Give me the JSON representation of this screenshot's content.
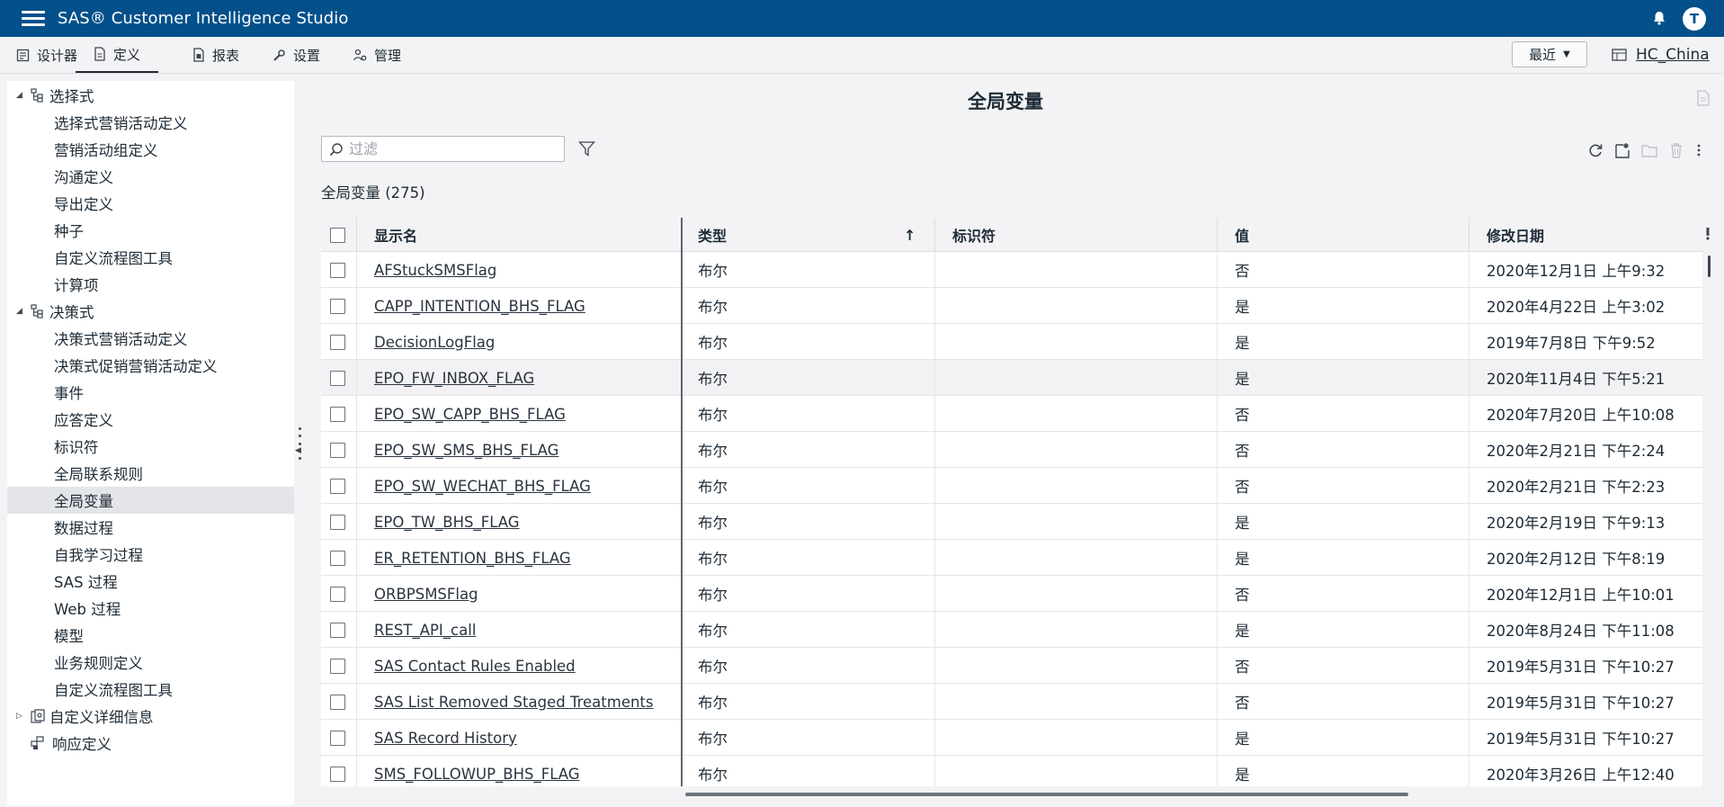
{
  "app": {
    "title": "SAS® Customer Intelligence Studio",
    "user_initial": "T"
  },
  "menubar": {
    "items": [
      {
        "label": "设计器",
        "icon": "designer-icon"
      },
      {
        "label": "定义",
        "icon": "document-icon"
      },
      {
        "label": "报表",
        "icon": "report-icon"
      },
      {
        "label": "设置",
        "icon": "wrench-icon"
      },
      {
        "label": "管理",
        "icon": "admin-icon"
      }
    ],
    "recent_label": "最近",
    "workspace_label": "HC_China"
  },
  "sidebar": {
    "groups": [
      {
        "label": "选择式",
        "expanded": true,
        "children": [
          "选择式营销活动定义",
          "营销活动组定义",
          "沟通定义",
          "导出定义",
          "种子",
          "自定义流程图工具",
          "计算项"
        ]
      },
      {
        "label": "决策式",
        "expanded": true,
        "children": [
          "决策式营销活动定义",
          "决策式促销营销活动定义",
          "事件",
          "应答定义",
          "标识符",
          "全局联系规则",
          "全局变量",
          "数据过程",
          "自我学习过程",
          "SAS 过程",
          "Web 过程",
          "模型",
          "业务规则定义",
          "自定义流程图工具"
        ]
      },
      {
        "label": "自定义详细信息",
        "expanded": false,
        "children": []
      },
      {
        "label": "响应定义",
        "expanded": null,
        "children": []
      }
    ],
    "selected": "全局变量"
  },
  "main": {
    "title": "全局变量",
    "filter_placeholder": "过滤",
    "count_label": "全局变量 (275)",
    "columns": [
      "显示名",
      "类型",
      "标识符",
      "值",
      "修改日期"
    ],
    "sort_column": "类型",
    "sort_direction": "ascending",
    "rows": [
      {
        "name": "AFStuckSMSFlag",
        "type": "布尔",
        "identifier": "",
        "value": "否",
        "modified": "2020年12月1日 上午9:32"
      },
      {
        "name": "CAPP_INTENTION_BHS_FLAG",
        "type": "布尔",
        "identifier": "",
        "value": "是",
        "modified": "2020年4月22日 上午3:02"
      },
      {
        "name": "DecisionLogFlag",
        "type": "布尔",
        "identifier": "",
        "value": "是",
        "modified": "2019年7月8日 下午9:52"
      },
      {
        "name": "EPO_FW_INBOX_FLAG",
        "type": "布尔",
        "identifier": "",
        "value": "是",
        "modified": "2020年11月4日 下午5:21"
      },
      {
        "name": "EPO_SW_CAPP_BHS_FLAG",
        "type": "布尔",
        "identifier": "",
        "value": "否",
        "modified": "2020年7月20日 上午10:08"
      },
      {
        "name": "EPO_SW_SMS_BHS_FLAG",
        "type": "布尔",
        "identifier": "",
        "value": "否",
        "modified": "2020年2月21日 下午2:24"
      },
      {
        "name": "EPO_SW_WECHAT_BHS_FLAG",
        "type": "布尔",
        "identifier": "",
        "value": "否",
        "modified": "2020年2月21日 下午2:23"
      },
      {
        "name": "EPO_TW_BHS_FLAG",
        "type": "布尔",
        "identifier": "",
        "value": "是",
        "modified": "2020年2月19日 下午9:13"
      },
      {
        "name": "ER_RETENTION_BHS_FLAG",
        "type": "布尔",
        "identifier": "",
        "value": "是",
        "modified": "2020年2月12日 下午8:19"
      },
      {
        "name": "ORBPSMSFlag",
        "type": "布尔",
        "identifier": "",
        "value": "否",
        "modified": "2020年12月1日 上午10:01"
      },
      {
        "name": "REST_API_call",
        "type": "布尔",
        "identifier": "",
        "value": "是",
        "modified": "2020年8月24日 下午11:08"
      },
      {
        "name": "SAS Contact Rules Enabled",
        "type": "布尔",
        "identifier": "",
        "value": "否",
        "modified": "2019年5月31日 下午10:27"
      },
      {
        "name": "SAS List Removed Staged Treatments",
        "type": "布尔",
        "identifier": "",
        "value": "否",
        "modified": "2019年5月31日 下午10:27"
      },
      {
        "name": "SAS Record History",
        "type": "布尔",
        "identifier": "",
        "value": "是",
        "modified": "2019年5月31日 下午10:27"
      },
      {
        "name": "SMS_FOLLOWUP_BHS_FLAG",
        "type": "布尔",
        "identifier": "",
        "value": "是",
        "modified": "2020年3月26日 上午12:40"
      }
    ],
    "hover_row": 3
  },
  "colors": {
    "header": "#03508a",
    "selected_row": "#e4e5e8",
    "page_bg": "#f3f3f5"
  }
}
